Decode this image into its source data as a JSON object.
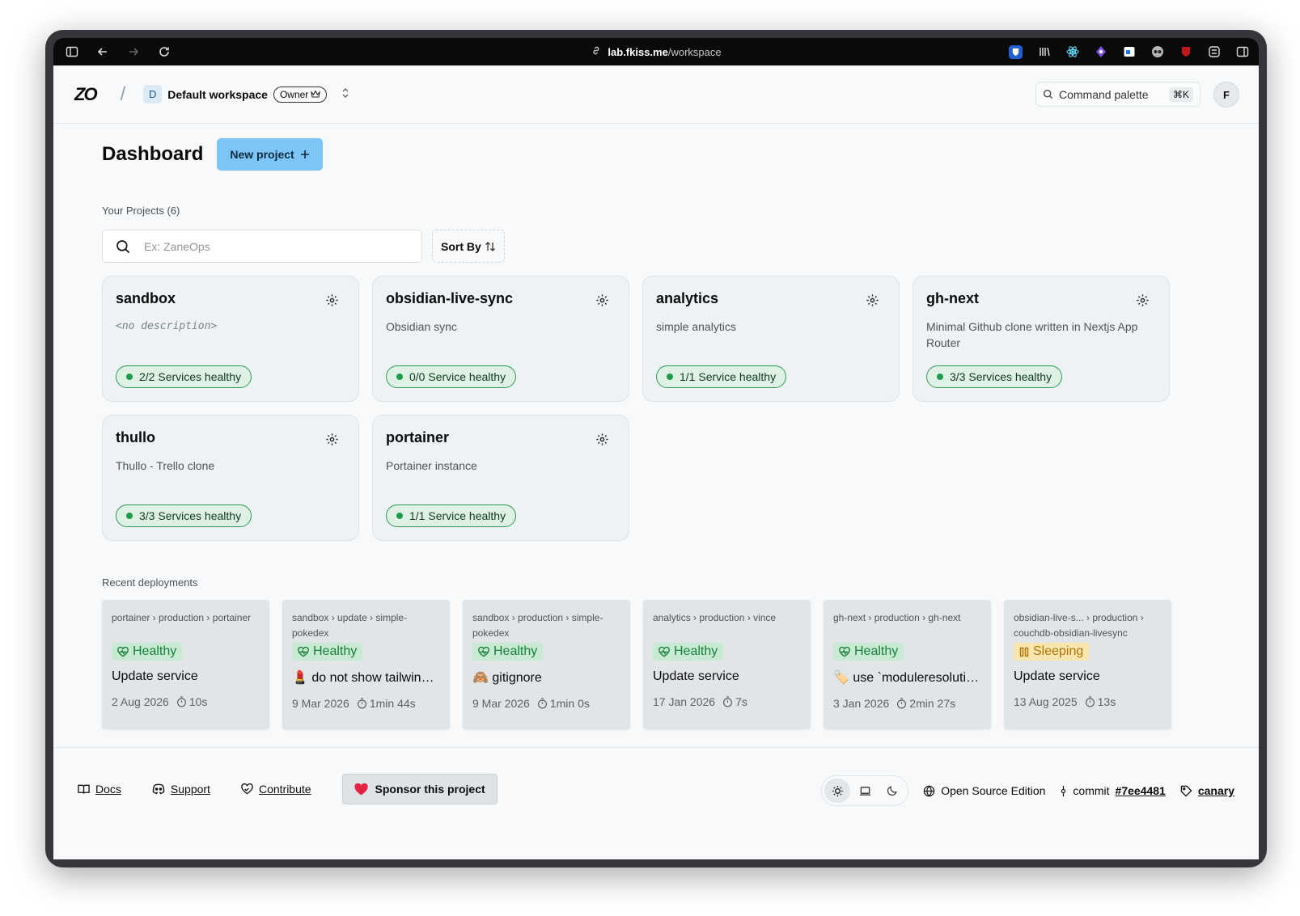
{
  "browser": {
    "url_host": "lab.fkiss.me",
    "url_path": "/workspace"
  },
  "header": {
    "logo": "ZO",
    "separator": "/",
    "workspace_initial": "D",
    "workspace_name": "Default workspace",
    "role_badge": "Owner",
    "command_palette": "Command palette",
    "command_shortcut": "⌘K",
    "avatar_initial": "F"
  },
  "main": {
    "title": "Dashboard",
    "new_project_label": "New project",
    "projects_label": "Your Projects (6)",
    "search_placeholder": "Ex: ZaneOps",
    "sort_label": "Sort By",
    "projects": [
      {
        "name": "sandbox",
        "description": "<no description>",
        "health": "2/2 Services healthy"
      },
      {
        "name": "obsidian-live-sync",
        "description": "Obsidian sync",
        "health": "0/0 Service healthy"
      },
      {
        "name": "analytics",
        "description": "simple analytics",
        "health": "1/1 Service healthy"
      },
      {
        "name": "gh-next",
        "description": "Minimal Github clone written in Nextjs App Router",
        "health": "3/3 Services healthy"
      },
      {
        "name": "thullo",
        "description": "Thullo - Trello clone",
        "health": "3/3 Services healthy"
      },
      {
        "name": "portainer",
        "description": "Portainer instance",
        "health": "1/1 Service healthy"
      }
    ],
    "recent_label": "Recent deployments",
    "deployments": [
      {
        "crumb1": "portainer",
        "crumb2": "production",
        "crumb3": "portainer",
        "status": "Healthy",
        "commit": "Update service",
        "date": "2 Aug 2026",
        "duration": "10s"
      },
      {
        "crumb1": "sandbox",
        "crumb2": "update",
        "crumb3": "simple-pokedex",
        "status": "Healthy",
        "commit": "💄 do not show tailwind css in production",
        "date": "9 Mar 2026",
        "duration": "1min 44s"
      },
      {
        "crumb1": "sandbox",
        "crumb2": "production",
        "crumb3": "simple-pokedex",
        "status": "Healthy",
        "commit": "🙈 gitignore",
        "date": "9 Mar 2026",
        "duration": "1min 0s"
      },
      {
        "crumb1": "analytics",
        "crumb2": "production",
        "crumb3": "vince",
        "status": "Healthy",
        "commit": "Update service",
        "date": "17 Jan 2026",
        "duration": "7s"
      },
      {
        "crumb1": "gh-next",
        "crumb2": "production",
        "crumb3": "gh-next",
        "status": "Healthy",
        "commit": "🏷️ use `moduleresolution`",
        "date": "3 Jan 2026",
        "duration": "2min 27s"
      },
      {
        "crumb1": "obsidian-live-s...",
        "crumb2": "production",
        "crumb3": "couchdb-obsidian-livesync",
        "status": "Sleeping",
        "commit": "Update service",
        "date": "13 Aug 2025",
        "duration": "13s"
      }
    ]
  },
  "footer": {
    "docs": "Docs",
    "support": "Support",
    "contribute": "Contribute",
    "sponsor": "Sponsor this project",
    "edition": "Open Source Edition",
    "commit_prefix": "commit",
    "commit_hash": "#7ee4481",
    "channel": "canary"
  }
}
